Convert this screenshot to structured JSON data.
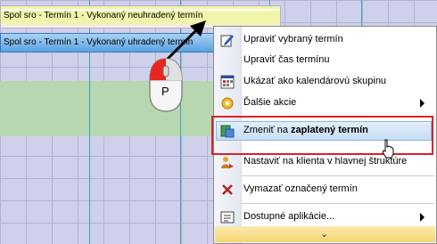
{
  "calendar": {
    "event_unpaid": "Spol sro - Termín 1 - Vykonaný neuhradený termín",
    "event_paid": "Spol sro - Termín 1 - Vykonaný uhradený termín"
  },
  "mouse": {
    "button_label": "P"
  },
  "context_menu": {
    "items": [
      {
        "label": "Upraviť vybraný termín",
        "icon": "edit-icon"
      },
      {
        "label": "Upraviť čas termínu"
      },
      {
        "label": "Ukázať ako kalendárovú skupinu",
        "icon": "calendar-grid-icon"
      },
      {
        "label": "Ďalšie akcie",
        "icon": "actions-icon",
        "has_submenu": true
      },
      {
        "label_prefix": "Zmeniť na ",
        "label_bold": "zaplatený termín",
        "icon": "paid-term-icon",
        "highlighted": true
      },
      {
        "label": "Nastaviť na klienta v hlavnej štruktúre",
        "icon": "client-icon"
      },
      {
        "label": "Vymazať označený termín",
        "icon": "delete-icon"
      },
      {
        "label": "Dostupné aplikácie...",
        "icon": "apps-icon",
        "has_submenu": true
      }
    ],
    "scroll_glyph": "⌄"
  },
  "colors": {
    "grid": "#cfd0ea",
    "highlight_border": "#e01f2a",
    "event_paid": "#5aa2e1"
  }
}
